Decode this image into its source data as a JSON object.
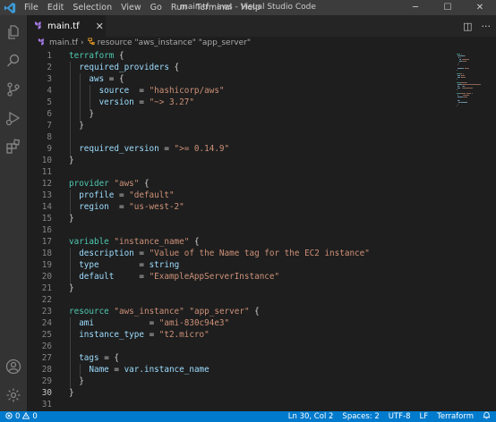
{
  "titlebar": {
    "menu": [
      "File",
      "Edit",
      "Selection",
      "View",
      "Go",
      "Run",
      "Terminal",
      "Help"
    ],
    "title": "main.tf - aws - Visual Studio Code",
    "controls": [
      "─",
      "☐",
      "✕"
    ]
  },
  "activity_bar": {
    "icons": [
      "explorer-icon",
      "search-icon",
      "source-control-icon",
      "run-debug-icon",
      "extensions-icon",
      "account-icon",
      "manage-icon"
    ]
  },
  "tabs": [
    {
      "label": "main.tf",
      "close": "✕",
      "active": true
    }
  ],
  "tab_actions": {
    "split": "◫",
    "more": "···"
  },
  "breadcrumb": {
    "file": "main.tf",
    "symbol": "resource \"aws_instance\" \"app_server\""
  },
  "editor": {
    "active_line": 30,
    "lines": [
      {
        "n": "1",
        "t": [
          [
            "kw",
            "terraform"
          ],
          [
            "op",
            " {"
          ]
        ]
      },
      {
        "n": "2",
        "t": [
          [
            "id",
            "  required_providers"
          ],
          [
            "op",
            " {"
          ]
        ]
      },
      {
        "n": "3",
        "t": [
          [
            "id",
            "    aws"
          ],
          [
            "op",
            " = {"
          ]
        ]
      },
      {
        "n": "4",
        "t": [
          [
            "id",
            "      source"
          ],
          [
            "op",
            "  = "
          ],
          [
            "str",
            "\"hashicorp/aws\""
          ]
        ]
      },
      {
        "n": "5",
        "t": [
          [
            "id",
            "      version"
          ],
          [
            "op",
            " = "
          ],
          [
            "str",
            "\"~> 3.27\""
          ]
        ]
      },
      {
        "n": "6",
        "t": [
          [
            "op",
            "    }"
          ]
        ]
      },
      {
        "n": "7",
        "t": [
          [
            "op",
            "  }"
          ]
        ]
      },
      {
        "n": "8",
        "t": []
      },
      {
        "n": "9",
        "t": [
          [
            "id",
            "  required_version"
          ],
          [
            "op",
            " = "
          ],
          [
            "str",
            "\">= 0.14.9\""
          ]
        ]
      },
      {
        "n": "10",
        "t": [
          [
            "op",
            "}"
          ]
        ]
      },
      {
        "n": "11",
        "t": []
      },
      {
        "n": "12",
        "t": [
          [
            "kw",
            "provider"
          ],
          [
            "op",
            " "
          ],
          [
            "str",
            "\"aws\""
          ],
          [
            "op",
            " {"
          ]
        ]
      },
      {
        "n": "13",
        "t": [
          [
            "id",
            "  profile"
          ],
          [
            "op",
            " = "
          ],
          [
            "str",
            "\"default\""
          ]
        ]
      },
      {
        "n": "14",
        "t": [
          [
            "id",
            "  region"
          ],
          [
            "op",
            "  = "
          ],
          [
            "str",
            "\"us-west-2\""
          ]
        ]
      },
      {
        "n": "15",
        "t": [
          [
            "op",
            "}"
          ]
        ]
      },
      {
        "n": "16",
        "t": []
      },
      {
        "n": "17",
        "t": [
          [
            "kw",
            "variable"
          ],
          [
            "op",
            " "
          ],
          [
            "str",
            "\"instance_name\""
          ],
          [
            "op",
            " {"
          ]
        ]
      },
      {
        "n": "18",
        "t": [
          [
            "id",
            "  description"
          ],
          [
            "op",
            " = "
          ],
          [
            "str",
            "\"Value of the Name tag for the EC2 instance\""
          ]
        ]
      },
      {
        "n": "19",
        "t": [
          [
            "id",
            "  type"
          ],
          [
            "op",
            "        = "
          ],
          [
            "ref",
            "string"
          ]
        ]
      },
      {
        "n": "20",
        "t": [
          [
            "id",
            "  default"
          ],
          [
            "op",
            "     = "
          ],
          [
            "str",
            "\"ExampleAppServerInstance\""
          ]
        ]
      },
      {
        "n": "21",
        "t": [
          [
            "op",
            "}"
          ]
        ]
      },
      {
        "n": "22",
        "t": []
      },
      {
        "n": "23",
        "t": [
          [
            "kw",
            "resource"
          ],
          [
            "op",
            " "
          ],
          [
            "str",
            "\"aws_instance\""
          ],
          [
            "op",
            " "
          ],
          [
            "str",
            "\"app_server\""
          ],
          [
            "op",
            " {"
          ]
        ]
      },
      {
        "n": "24",
        "t": [
          [
            "id",
            "  ami"
          ],
          [
            "op",
            "           = "
          ],
          [
            "str",
            "\"ami-830c94e3\""
          ]
        ]
      },
      {
        "n": "25",
        "t": [
          [
            "id",
            "  instance_type"
          ],
          [
            "op",
            " = "
          ],
          [
            "str",
            "\"t2.micro\""
          ]
        ]
      },
      {
        "n": "26",
        "t": []
      },
      {
        "n": "27",
        "t": [
          [
            "id",
            "  tags"
          ],
          [
            "op",
            " = {"
          ]
        ]
      },
      {
        "n": "28",
        "t": [
          [
            "id",
            "    Name"
          ],
          [
            "op",
            " = "
          ],
          [
            "ref",
            "var.instance_name"
          ]
        ]
      },
      {
        "n": "29",
        "t": [
          [
            "op",
            "  }"
          ]
        ]
      },
      {
        "n": "30",
        "t": [
          [
            "op",
            "}"
          ]
        ]
      },
      {
        "n": "31",
        "t": []
      }
    ]
  },
  "statusbar": {
    "errors": "0",
    "warnings": "0",
    "position": "Ln 30, Col 2",
    "spaces": "Spaces: 2",
    "encoding": "UTF-8",
    "eol": "LF",
    "language": "Terraform"
  },
  "colors": {
    "accent": "#007acc",
    "keyword": "#4ec9b0",
    "string": "#ce9178",
    "property": "#9cdcfe",
    "terraform_icon": "#a77ce6"
  }
}
